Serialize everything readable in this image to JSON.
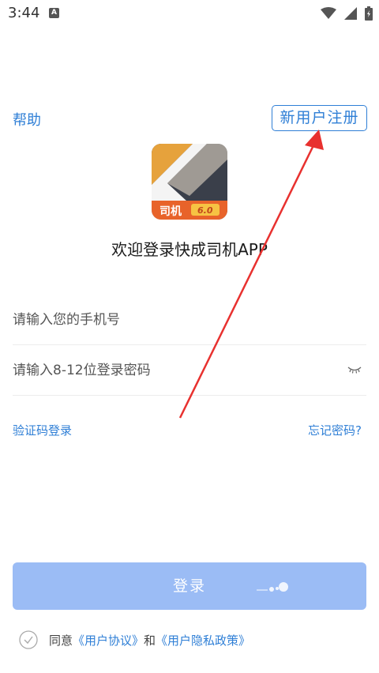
{
  "status_bar": {
    "time": "3:44",
    "notification_badge": "A",
    "icons": [
      "wifi-icon",
      "signal-icon",
      "battery-icon"
    ]
  },
  "header": {
    "help_label": "帮助",
    "register_label": "新用户注册"
  },
  "logo": {
    "badge_text": "司机",
    "version_text": "6.0"
  },
  "welcome_text": "欢迎登录快成司机APP",
  "form": {
    "phone_placeholder": "请输入您的手机号",
    "password_placeholder": "请输入8-12位登录密码"
  },
  "links": {
    "sms_login": "验证码登录",
    "forgot_password": "忘记密码?"
  },
  "login_button": "登录",
  "agreement": {
    "prefix": "同意",
    "user_agreement": "《用户协议》",
    "conjunction": "和",
    "privacy_policy": "《用户隐私政策》"
  },
  "colors": {
    "accent": "#2f7fd6",
    "login_button": "#9bbcf5",
    "annotation_arrow": "#e8312f",
    "logo_orange": "#e98a2a",
    "logo_dark": "#3a3f4a"
  }
}
